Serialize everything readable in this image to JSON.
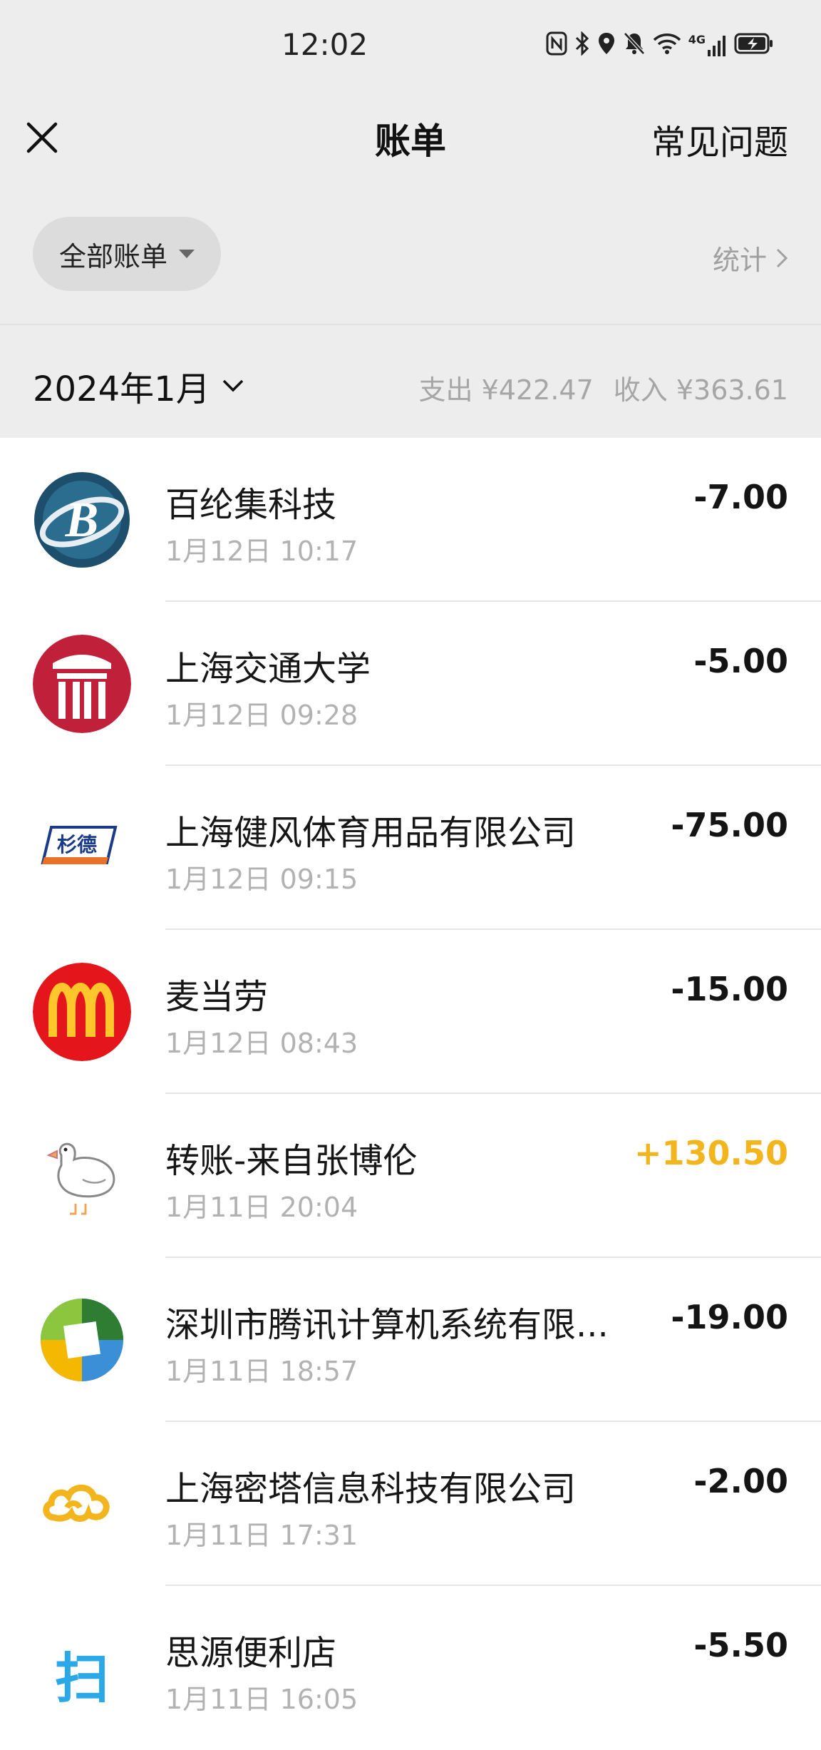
{
  "status_bar": {
    "time": "12:02",
    "network_label": "4G",
    "icons": [
      "nfc-icon",
      "bluetooth-icon",
      "location-icon",
      "mute-icon",
      "wifi-icon",
      "signal-icon",
      "battery-charging-icon"
    ]
  },
  "nav": {
    "title": "账单",
    "faq": "常见问题"
  },
  "filter": {
    "all_bills": "全部账单",
    "stats": "统计"
  },
  "month": {
    "label": "2024年1月",
    "expense": "支出 ¥422.47",
    "income": "收入 ¥363.61"
  },
  "colors": {
    "income_amount": "#f2b51d",
    "background_gray": "#ededed"
  },
  "transactions": [
    {
      "name": "百纶集科技",
      "time": "1月12日 10:17",
      "amount": "-7.00",
      "icon": "bailunji-logo-icon"
    },
    {
      "name": "上海交通大学",
      "time": "1月12日 09:28",
      "amount": "-5.00",
      "icon": "sjtu-logo-icon"
    },
    {
      "name": "上海健风体育用品有限公司",
      "time": "1月12日 09:15",
      "amount": "-75.00",
      "icon": "shande-logo-icon",
      "logo_text": "杉德"
    },
    {
      "name": "麦当劳",
      "time": "1月12日 08:43",
      "amount": "-15.00",
      "icon": "mcdonalds-logo-icon"
    },
    {
      "name": "转账-来自张博伦",
      "time": "1月11日 20:04",
      "amount": "+130.50",
      "icon": "goose-avatar-icon"
    },
    {
      "name": "深圳市腾讯计算机系统有限...",
      "time": "1月11日 18:57",
      "amount": "-19.00",
      "icon": "tencent-logo-icon"
    },
    {
      "name": "上海密塔信息科技有限公司",
      "time": "1月11日 17:31",
      "amount": "-2.00",
      "icon": "cloud-logo-icon"
    },
    {
      "name": "思源便利店",
      "time": "1月11日 16:05",
      "amount": "-5.50",
      "icon": "scan-logo-icon",
      "logo_text": "扫"
    }
  ]
}
